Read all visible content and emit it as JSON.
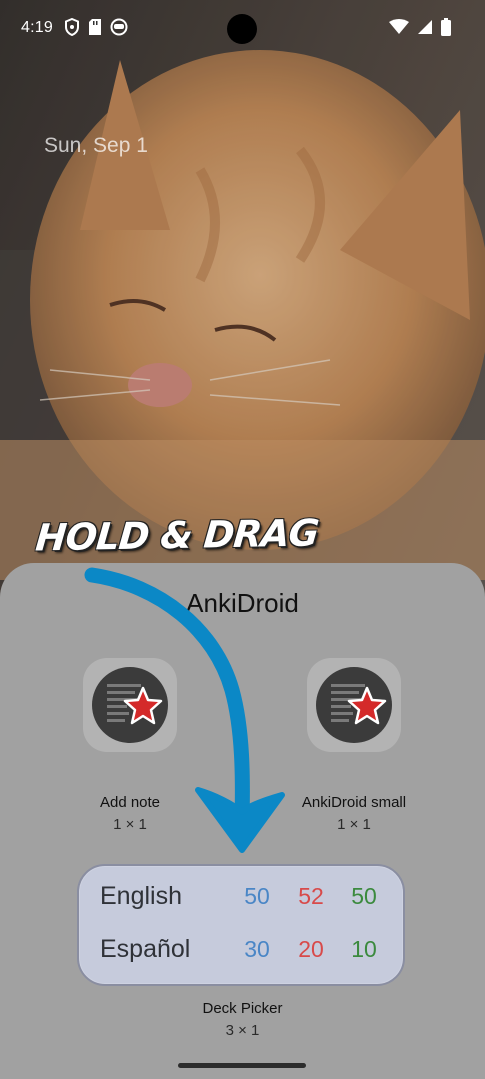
{
  "status_bar": {
    "time": "4:19",
    "left_icons": [
      "shield-icon",
      "sd-card-icon",
      "vpn-face-icon"
    ],
    "right_icons": [
      "wifi-icon",
      "signal-icon",
      "battery-icon"
    ]
  },
  "lock_screen": {
    "date": "Sun, Sep 1"
  },
  "overlay": {
    "hold_drag_text": "HOLD & DRAG",
    "arrow_color": "#0b88c6"
  },
  "widget_picker": {
    "app_name": "AnkiDroid",
    "options": [
      {
        "name": "Add note",
        "size": "1 × 1",
        "icon": "ankidroid-app-icon"
      },
      {
        "name": "AnkiDroid small",
        "size": "1 × 1",
        "icon": "ankidroid-app-icon"
      }
    ],
    "deck_picker": {
      "name": "Deck Picker",
      "size": "3 × 1",
      "decks": [
        {
          "name": "English",
          "new": "50",
          "learn": "52",
          "review": "50"
        },
        {
          "name": "Español",
          "new": "30",
          "learn": "20",
          "review": "10"
        }
      ],
      "colors": {
        "new": "#4a86c6",
        "learn": "#d84a4a",
        "review": "#3b8a3e"
      }
    }
  }
}
